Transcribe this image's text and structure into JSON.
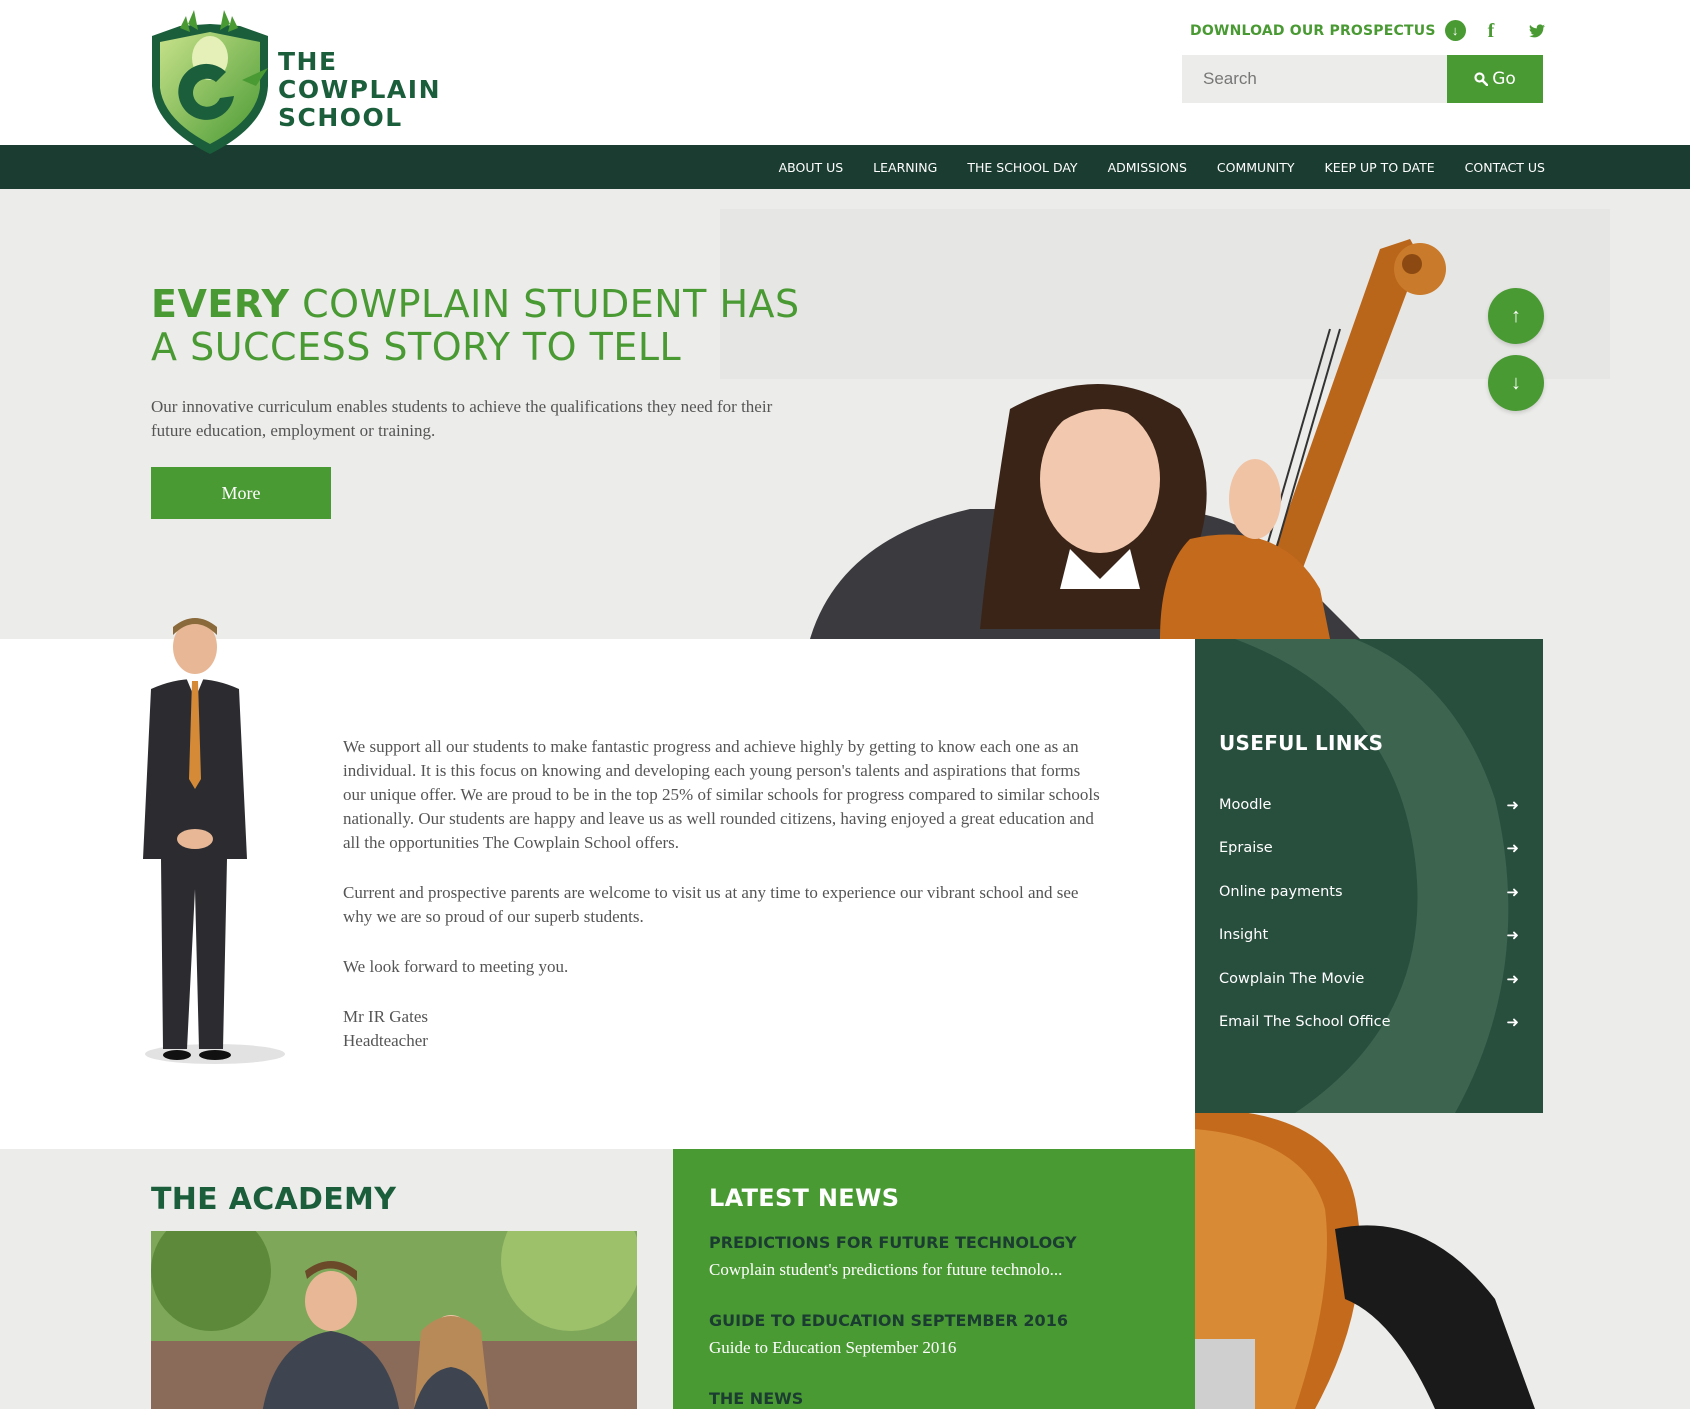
{
  "header": {
    "logo_lines": [
      "THE",
      "COWPLAIN",
      "SCHOOL"
    ],
    "prospectus_label": "DOWNLOAD OUR PROSPECTUS",
    "prospectus_icon": "arrow-down-icon",
    "social": [
      "facebook-icon",
      "twitter-icon"
    ],
    "search": {
      "placeholder": "Search",
      "value": "",
      "button_label": "Go",
      "button_icon": "search-icon"
    }
  },
  "nav": {
    "items": [
      "ABOUT US",
      "LEARNING",
      "THE SCHOOL DAY",
      "ADMISSIONS",
      "COMMUNITY",
      "KEEP UP TO DATE",
      "CONTACT US"
    ]
  },
  "hero": {
    "title_bold": "EVERY",
    "title_rest": "COWPLAIN STUDENT HAS",
    "title_line2": "A SUCCESS STORY TO TELL",
    "text": "Our innovative curriculum enables students to achieve the qualifications they need for their future education, employment or training.",
    "button_label": "More",
    "scroll_up_icon": "arrow-up-icon",
    "scroll_down_icon": "arrow-down-icon"
  },
  "welcome": {
    "paragraphs": [
      "We support all our students to make fantastic progress and achieve highly by getting to know each one as an individual. It is this focus on knowing and developing each young person's talents and aspirations that forms our unique offer. We are proud to be in the top 25% of similar schools for progress compared to similar schools nationally.  Our students are happy and leave us as well rounded citizens, having enjoyed a great education and all the opportunities The Cowplain School offers.",
      "Current and prospective parents are welcome to visit us at any time to experience our vibrant school and see why we are so proud of our superb students.",
      "We look forward to meeting you."
    ],
    "signature_name": "Mr IR Gates",
    "signature_role": "Headteacher"
  },
  "useful_links": {
    "title": "USEFUL LINKS",
    "items": [
      "Moodle",
      "Epraise",
      "Online payments",
      "Insight",
      "Cowplain The Movie",
      "Email The School Office"
    ]
  },
  "academy": {
    "title": "THE ACADEMY"
  },
  "news": {
    "title": "LATEST NEWS",
    "items": [
      {
        "headline": "PREDICTIONS FOR FUTURE TECHNOLOGY",
        "summary": "Cowplain student's predictions for future technolo..."
      },
      {
        "headline": "GUIDE TO EDUCATION SEPTEMBER 2016",
        "summary": "Guide to Education September 2016"
      },
      {
        "headline": "THE NEWS",
        "summary": ""
      }
    ]
  },
  "colors": {
    "brand_green": "#4a9a34",
    "dark_green": "#1b3c30",
    "panel_green": "#284e3e",
    "logo_green": "#1b5e3b",
    "hero_bg": "#ececea"
  }
}
